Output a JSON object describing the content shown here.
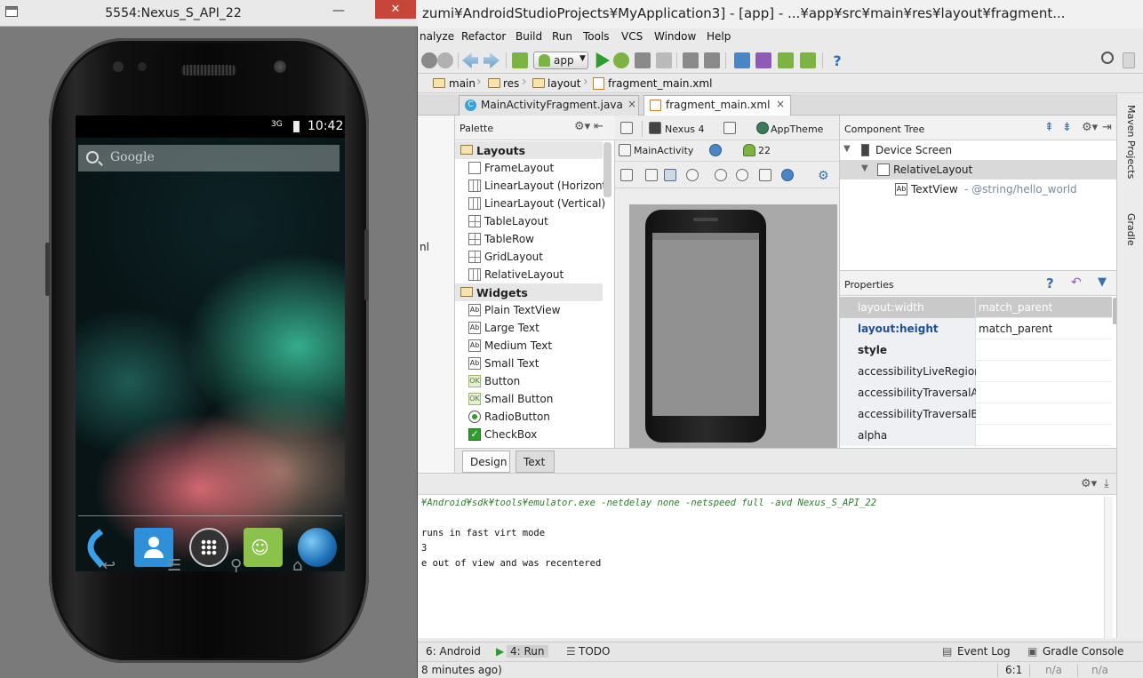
{
  "emulator": {
    "title": "5554:Nexus_S_API_22",
    "minimize": "—",
    "close": "✕",
    "status": {
      "signal": "3G",
      "time": "10:42"
    },
    "search_placeholder": "Google"
  },
  "ide": {
    "title": "zumi¥AndroidStudioProjects¥MyApplication3] - [app] - ...¥app¥src¥main¥res¥layout¥fragment...",
    "menu": [
      "nalyze",
      "Refactor",
      "Build",
      "Run",
      "Tools",
      "VCS",
      "Window",
      "Help"
    ],
    "run_config": "app",
    "breadcrumbs": [
      "main",
      "res",
      "layout",
      "fragment_main.xml"
    ],
    "editor_tabs": [
      {
        "label": "MainActivityFragment.java",
        "close": "×"
      },
      {
        "label": "fragment_main.xml",
        "close": "×"
      }
    ],
    "project_selected": "nl",
    "palette": {
      "title": "Palette",
      "items": [
        {
          "label": "Layouts",
          "category": true
        },
        {
          "label": "FrameLayout"
        },
        {
          "label": "LinearLayout (Horizont"
        },
        {
          "label": "LinearLayout (Vertical)"
        },
        {
          "label": "TableLayout"
        },
        {
          "label": "TableRow"
        },
        {
          "label": "GridLayout"
        },
        {
          "label": "RelativeLayout"
        },
        {
          "label": "Widgets",
          "category": true
        },
        {
          "label": "Plain TextView",
          "icon": "Ab"
        },
        {
          "label": "Large Text",
          "icon": "Ab"
        },
        {
          "label": "Medium Text",
          "icon": "Ab"
        },
        {
          "label": "Small Text",
          "icon": "Ab"
        },
        {
          "label": "Button",
          "icon": "OK"
        },
        {
          "label": "Small Button",
          "icon": "OK"
        },
        {
          "label": "RadioButton"
        },
        {
          "label": "CheckBox",
          "icon": "✓"
        }
      ]
    },
    "design_toolbar": {
      "device": "Nexus 4",
      "theme": "AppTheme",
      "activity": "MainActivity",
      "api": "22"
    },
    "component_tree": {
      "title": "Component Tree",
      "device_screen": "Device Screen",
      "relative_layout": "RelativeLayout",
      "textview": "TextView",
      "textview_hint": "- @string/hello_world",
      "textview_icon": "Ab"
    },
    "properties": {
      "title": "Properties",
      "help": "?",
      "rows": [
        {
          "name": "layout:width",
          "value": "match_parent"
        },
        {
          "name": "layout:height",
          "value": "match_parent"
        },
        {
          "name": "style",
          "value": ""
        },
        {
          "name": "accessibilityLiveRegion",
          "value": ""
        },
        {
          "name": "accessibilityTraversalAfter",
          "value": ""
        },
        {
          "name": "accessibilityTraversalBefore",
          "value": ""
        },
        {
          "name": "alpha",
          "value": ""
        }
      ]
    },
    "side_tools": [
      "Maven Projects",
      "Gradle"
    ],
    "design_tabs": [
      "Design",
      "Text"
    ],
    "console_lines": [
      "¥Android¥sdk¥tools¥emulator.exe -netdelay none -netspeed full -avd Nexus_S_API_22",
      "",
      "runs in fast virt mode",
      "3",
      "e out of view and was recentered"
    ],
    "tool_windows": [
      "6: Android",
      "4: Run",
      "TODO",
      "Event Log",
      "Gradle Console"
    ],
    "status": {
      "message": "8 minutes ago)",
      "position": "6:1",
      "na1": "n/a",
      "na2": "n/a"
    }
  }
}
